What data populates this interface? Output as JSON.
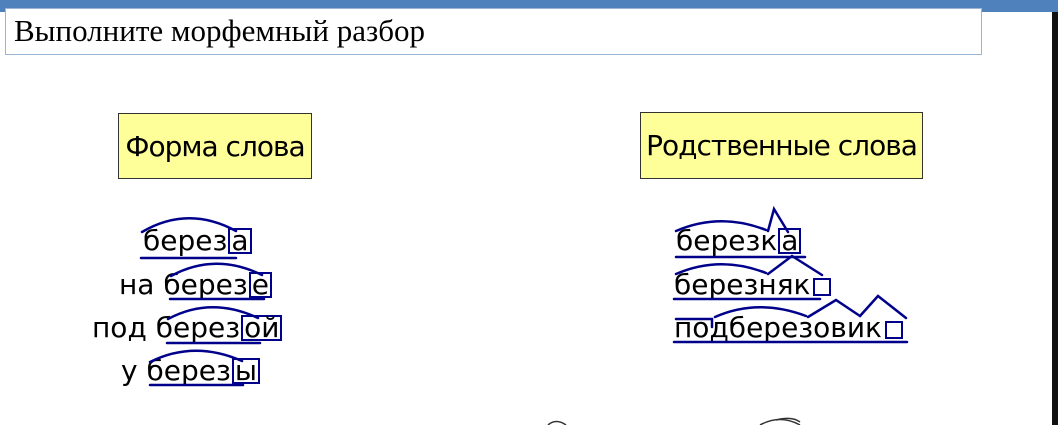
{
  "header": {
    "title": "Выполните морфемный разбор",
    "accent_color": "#4f81bd"
  },
  "left": {
    "label": "Форма слова",
    "rows": [
      {
        "prefix": "",
        "stem": "берез",
        "ending": "а"
      },
      {
        "prefix": "на ",
        "stem": "березе",
        "ending": ""
      },
      {
        "prefix": "под ",
        "stem": "берез",
        "ending": "ой"
      },
      {
        "prefix": "у ",
        "stem": "берез",
        "ending": "ы"
      }
    ]
  },
  "right": {
    "label": "Родственные слова",
    "rows": [
      {
        "word": "березк",
        "ending": "а"
      },
      {
        "word": "березняк",
        "ending": ""
      },
      {
        "word": "подберезовик",
        "ending": ""
      }
    ]
  },
  "colors": {
    "morpheme_marks": "#00008b",
    "label_bg": "#ffff99"
  }
}
